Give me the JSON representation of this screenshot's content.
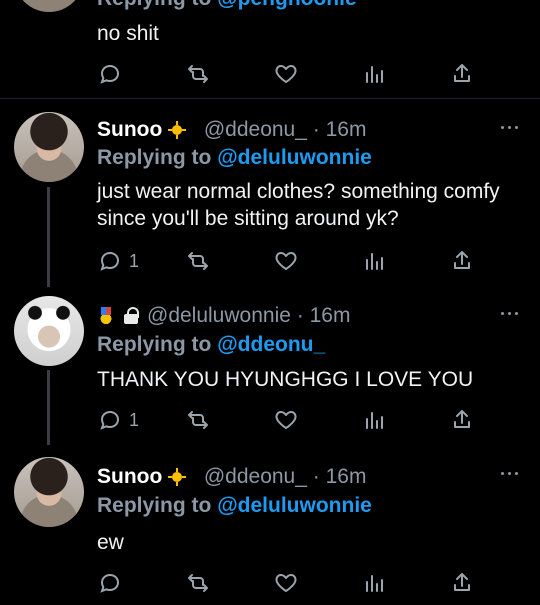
{
  "top_partial": {
    "replying_prefix": "Replying to",
    "reply_to": "@penghoonie",
    "body": "no shit"
  },
  "tweets": [
    {
      "name": "Sunoo",
      "name_icon": "sun-icon",
      "handle": "@ddeonu_",
      "dot": "·",
      "time": "16m",
      "replying_prefix": "Replying to",
      "reply_to": "@deluluwonnie",
      "body": "just wear normal clothes? something comfy since you'll be sitting around yk?",
      "reply_count": "1"
    },
    {
      "name_icons": [
        "medal-icon",
        "lock-icon"
      ],
      "handle": "@deluluwonnie",
      "dot": "·",
      "time": "16m",
      "replying_prefix": "Replying to",
      "reply_to": "@ddeonu_",
      "body": "THANK YOU HYUNGHGG I LOVE YOU",
      "reply_count": "1"
    },
    {
      "name": "Sunoo",
      "name_icon": "sun-icon",
      "handle": "@ddeonu_",
      "dot": "·",
      "time": "16m",
      "replying_prefix": "Replying to",
      "reply_to": "@deluluwonnie",
      "body": "ew",
      "reply_count": ""
    }
  ],
  "colors": {
    "background": "#000000",
    "text": "#e7e9ea",
    "muted": "#8b98a5",
    "link": "#1d9bf0"
  }
}
